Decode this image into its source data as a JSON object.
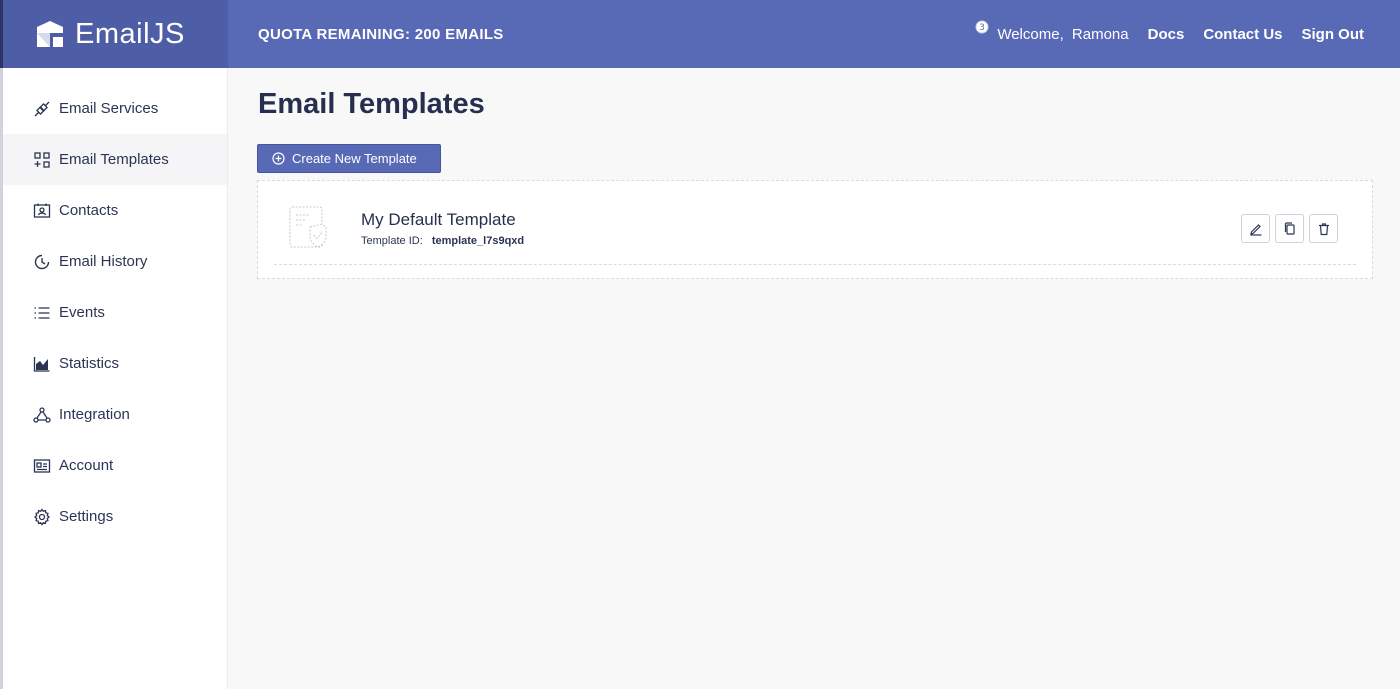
{
  "header": {
    "brand": "EmailJS",
    "quota": "QUOTA REMAINING: 200 EMAILS",
    "welcome": "Welcome,",
    "user": "Ramona",
    "notification_count": "3",
    "links": [
      "Docs",
      "Contact Us",
      "Sign Out"
    ]
  },
  "sidebar": {
    "items": [
      {
        "label": "Email Services",
        "icon": "plug-icon"
      },
      {
        "label": "Email Templates",
        "icon": "templates-icon",
        "active": true
      },
      {
        "label": "Contacts",
        "icon": "contacts-icon"
      },
      {
        "label": "Email History",
        "icon": "history-icon"
      },
      {
        "label": "Events",
        "icon": "list-icon"
      },
      {
        "label": "Statistics",
        "icon": "chart-icon"
      },
      {
        "label": "Integration",
        "icon": "integration-icon"
      },
      {
        "label": "Account",
        "icon": "id-card-icon"
      },
      {
        "label": "Settings",
        "icon": "gear-icon"
      }
    ]
  },
  "main": {
    "title": "Email Templates",
    "create_label": "Create New Template",
    "templates": [
      {
        "name": "My Default Template",
        "id_label": "Template ID:",
        "id_value": "template_l7s9qxd"
      }
    ]
  },
  "colors": {
    "header_bg": "#5869b6",
    "brand_bg": "#4e5ea6",
    "accent": "#5869b6",
    "text_dark": "#26304e"
  }
}
